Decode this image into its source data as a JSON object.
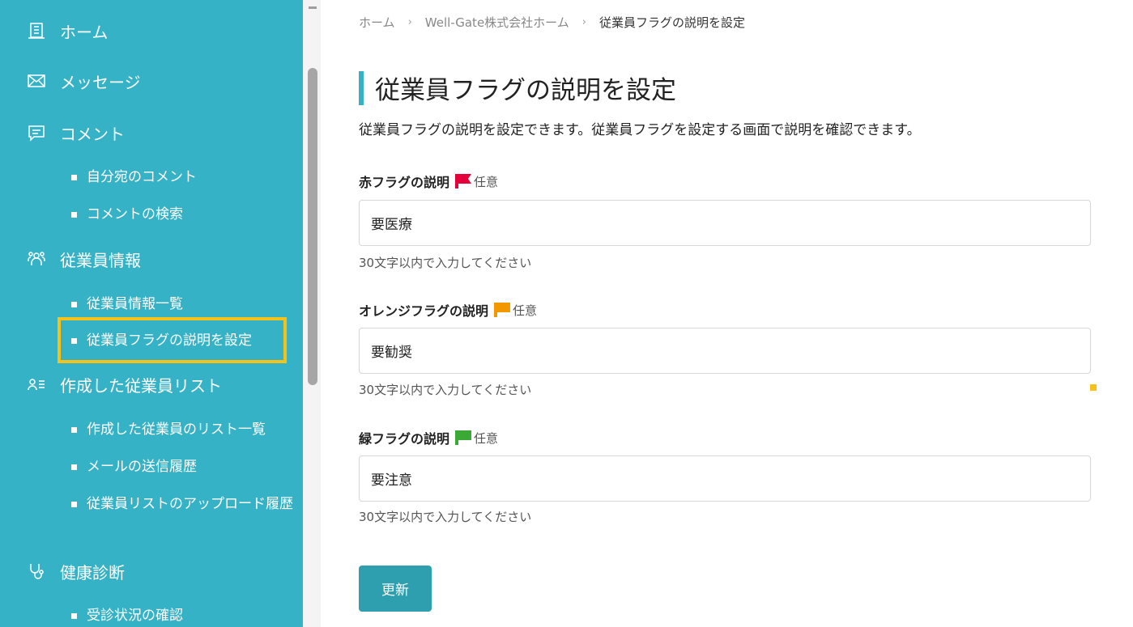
{
  "sidebar": {
    "nav": [
      {
        "label": "ホーム",
        "icon": "building-icon"
      },
      {
        "label": "メッセージ",
        "icon": "envelope-icon"
      },
      {
        "label": "コメント",
        "icon": "comment-icon"
      },
      {
        "label": "従業員情報",
        "icon": "people-icon"
      },
      {
        "label": "作成した従業員リスト",
        "icon": "person-list-icon"
      },
      {
        "label": "健康診断",
        "icon": "stethoscope-icon"
      }
    ],
    "sub": {
      "comment_mine": "自分宛のコメント",
      "comment_search": "コメントの検索",
      "employee_list": "従業員情報一覧",
      "employee_flag": "従業員フラグの説明を設定",
      "list_index": "作成した従業員のリスト一覧",
      "mail_history": "メールの送信履歴",
      "upload_history": "従業員リストのアップロード履歴",
      "checkup_status": "受診状況の確認"
    }
  },
  "breadcrumb": {
    "home": "ホーム",
    "company": "Well-Gate株式会社ホーム",
    "current": "従業員フラグの説明を設定",
    "separator": "›"
  },
  "page": {
    "title": "従業員フラグの説明を設定",
    "description": "従業員フラグの説明を設定できます。従業員フラグを設定する画面で説明を確認できます。"
  },
  "fields": [
    {
      "label": "赤フラグの説明",
      "optional": "任意",
      "value": "要医療",
      "hint": "30文字以内で入力してください",
      "flag_color": "#e4003a"
    },
    {
      "label": "オレンジフラグの説明",
      "optional": "任意",
      "value": "要勧奨",
      "hint": "30文字以内で入力してください",
      "flag_color": "#f39800"
    },
    {
      "label": "緑フラグの説明",
      "optional": "任意",
      "value": "要注意",
      "hint": "30文字以内で入力してください",
      "flag_color": "#3aa935"
    }
  ],
  "submit_label": "更新",
  "colors": {
    "sidebar": "#35b2c6",
    "highlight": "#f6c21a",
    "button": "#2e9fae"
  }
}
